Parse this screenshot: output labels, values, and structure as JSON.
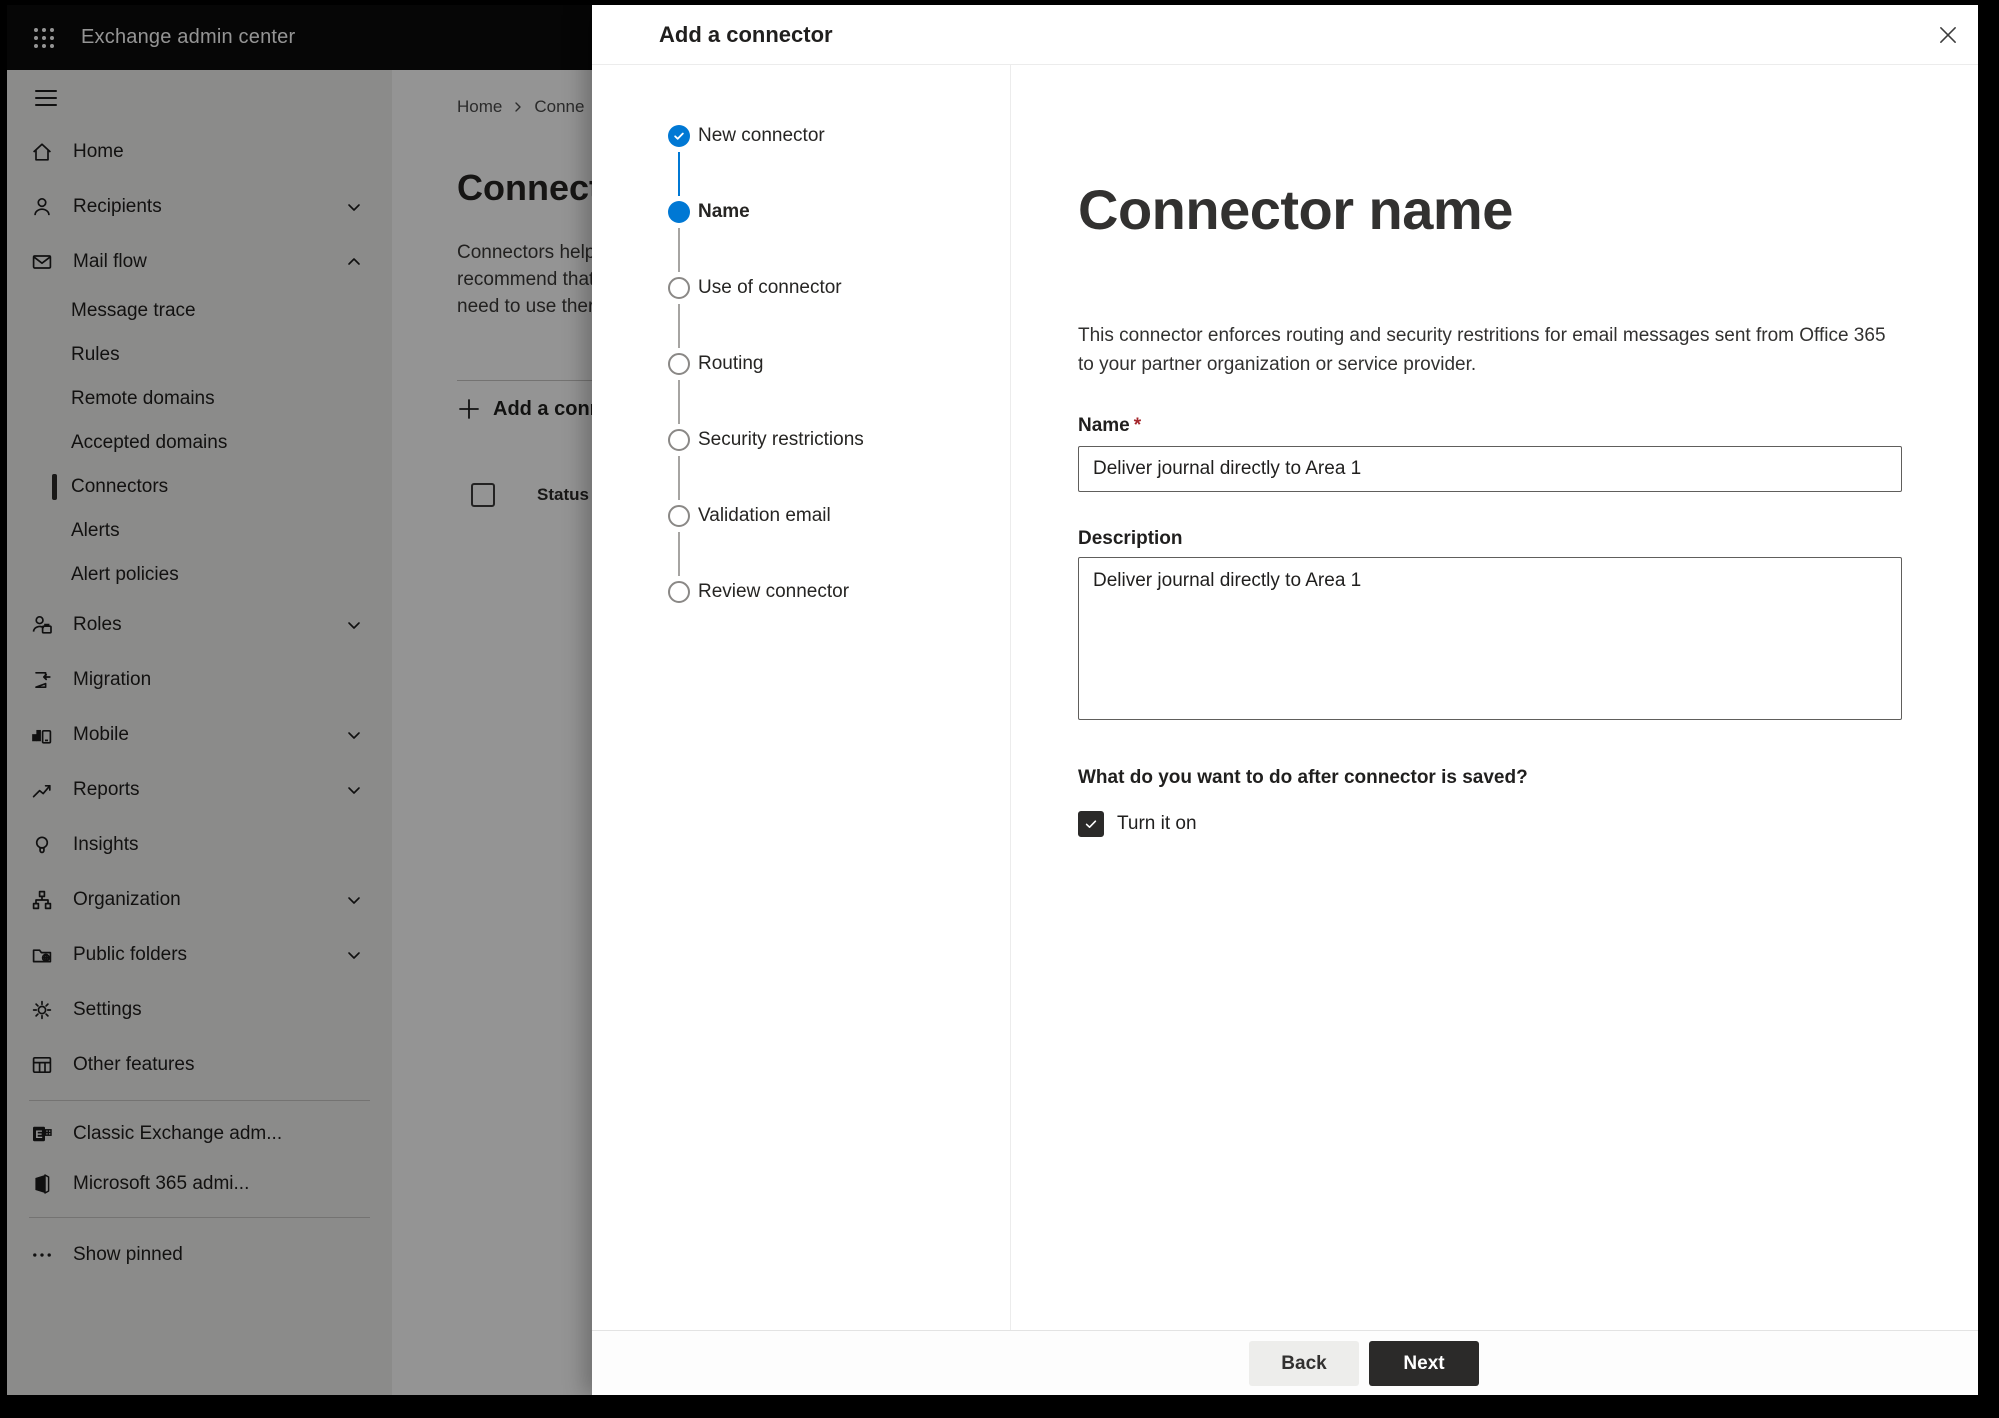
{
  "topbar": {
    "title": "Exchange admin center"
  },
  "sidebar": {
    "items": [
      {
        "label": "Home",
        "icon": "home"
      },
      {
        "label": "Recipients",
        "icon": "person",
        "chevron": "down"
      },
      {
        "label": "Mail flow",
        "icon": "mail",
        "chevron": "up",
        "expanded": true
      },
      {
        "label": "Message trace",
        "sub": true
      },
      {
        "label": "Rules",
        "sub": true
      },
      {
        "label": "Remote domains",
        "sub": true
      },
      {
        "label": "Accepted domains",
        "sub": true
      },
      {
        "label": "Connectors",
        "sub": true,
        "selected": true
      },
      {
        "label": "Alerts",
        "sub": true
      },
      {
        "label": "Alert policies",
        "sub": true
      },
      {
        "label": "Roles",
        "icon": "person-badge",
        "chevron": "down"
      },
      {
        "label": "Migration",
        "icon": "document-arrow"
      },
      {
        "label": "Mobile",
        "icon": "device-bars",
        "chevron": "down"
      },
      {
        "label": "Reports",
        "icon": "chart",
        "chevron": "down"
      },
      {
        "label": "Insights",
        "icon": "lightbulb"
      },
      {
        "label": "Organization",
        "icon": "org-tree",
        "chevron": "down"
      },
      {
        "label": "Public folders",
        "icon": "folder-globe",
        "chevron": "down"
      },
      {
        "label": "Settings",
        "icon": "gear"
      },
      {
        "label": "Other features",
        "icon": "table"
      },
      {
        "label": "Classic Exchange adm...",
        "icon": "exchange-logo"
      },
      {
        "label": "Microsoft 365 admi...",
        "icon": "office-logo"
      },
      {
        "label": "Show pinned",
        "icon": "ellipsis"
      }
    ]
  },
  "page": {
    "breadcrumb": [
      "Home",
      "Conne"
    ],
    "title": "Connect",
    "intro_lines": [
      "Connectors help",
      "recommend that",
      "need to use ther"
    ],
    "add_button_label": "Add a conn",
    "status_header": "Status"
  },
  "dialog": {
    "title": "Add a connector",
    "stepper": [
      {
        "label": "New connector",
        "state": "done"
      },
      {
        "label": "Name",
        "state": "current"
      },
      {
        "label": "Use of connector",
        "state": "todo"
      },
      {
        "label": "Routing",
        "state": "todo"
      },
      {
        "label": "Security restrictions",
        "state": "todo"
      },
      {
        "label": "Validation email",
        "state": "todo"
      },
      {
        "label": "Review connector",
        "state": "todo"
      }
    ],
    "content": {
      "heading": "Connector name",
      "description_lines": [
        "This connector enforces routing and security restritions for email messages sent from Office 365",
        "to your partner organization or service provider."
      ],
      "name_label": "Name",
      "required_mark": "*",
      "name_value": "Deliver journal directly to Area 1",
      "description_label": "Description",
      "description_value": "Deliver journal directly to Area 1",
      "question": "What do you want to do after connector is saved?",
      "turn_on_label": "Turn it on",
      "turn_on_checked": true
    },
    "footer": {
      "back_label": "Back",
      "next_label": "Next"
    }
  },
  "colors": {
    "accent_blue": "#0078d4",
    "primary_button": "#2b2a29",
    "required_asterisk": "#a4262c",
    "topbar_background": "#0b0b0b"
  }
}
